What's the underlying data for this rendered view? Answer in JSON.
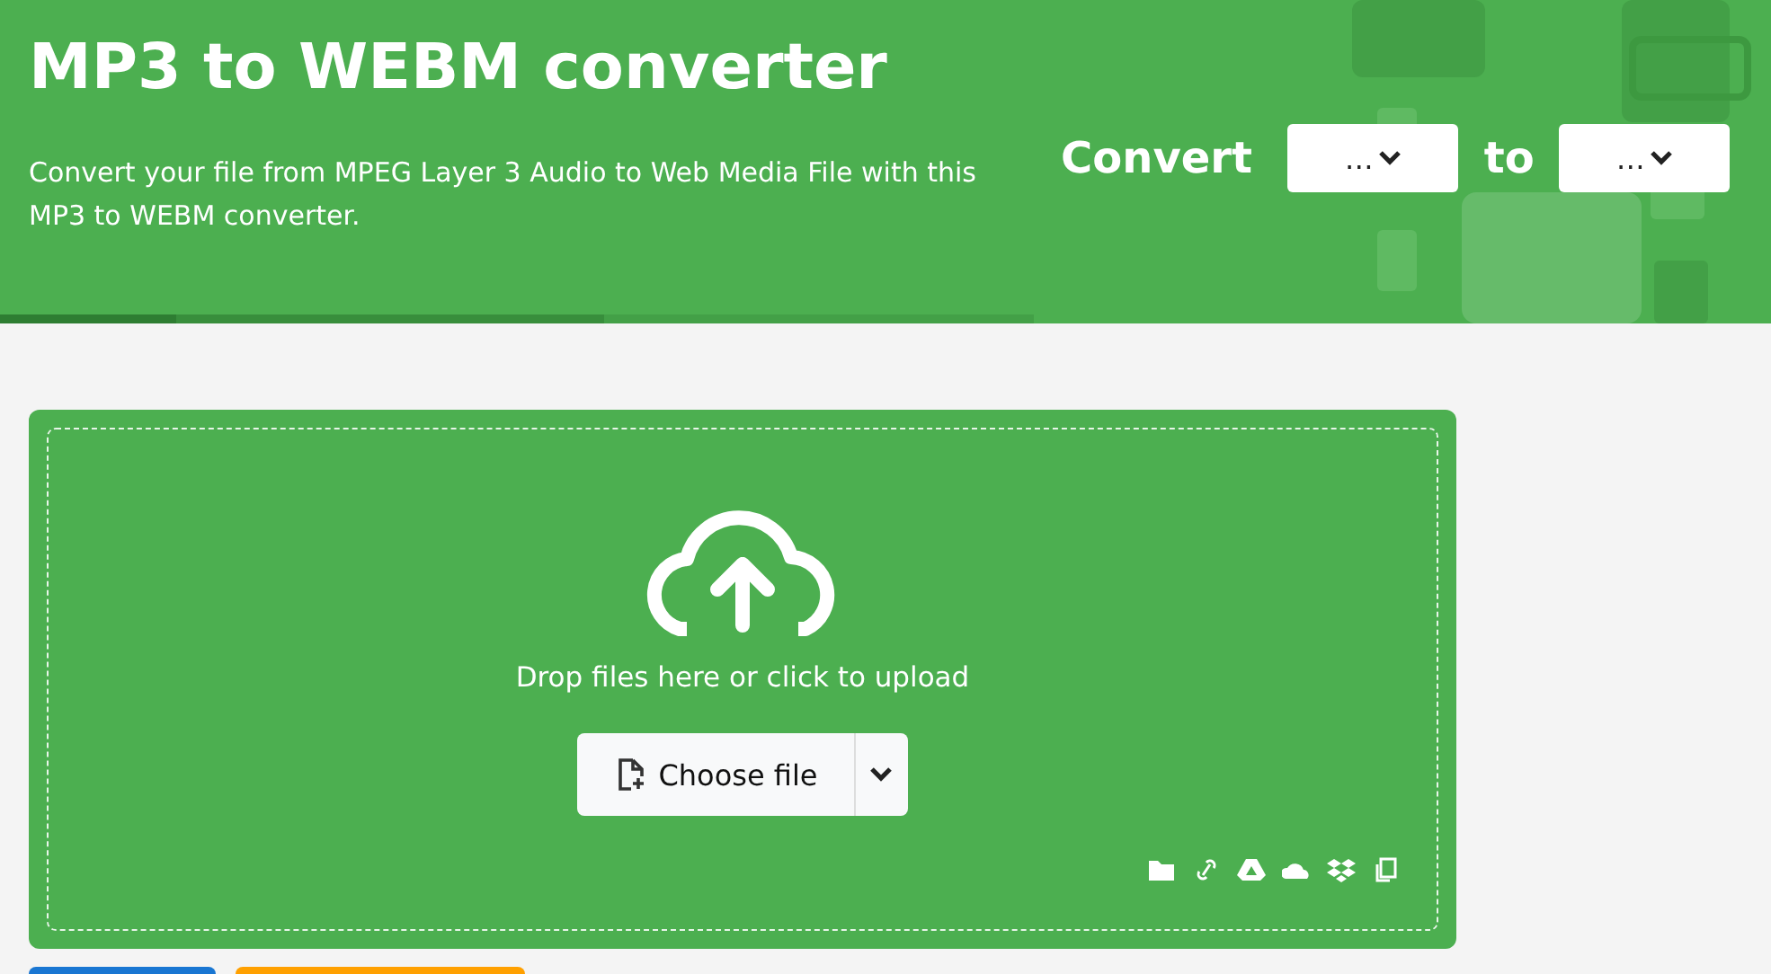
{
  "header": {
    "title": "MP3 to WEBM converter",
    "description": "Convert your file from MPEG Layer 3 Audio to Web Media File with this MP3 to WEBM converter.",
    "convert_label": "Convert",
    "from_select": "…",
    "to_label": "to",
    "to_select": "…"
  },
  "upload": {
    "message": "Drop files here or click to upload",
    "button": "Choose file"
  }
}
